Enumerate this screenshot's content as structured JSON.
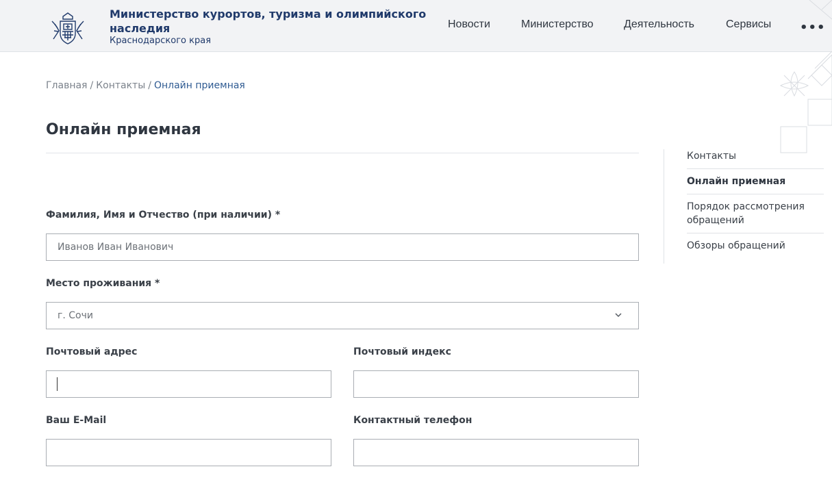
{
  "header": {
    "org_title": "Министерство курортов, туризма и олимпийского наследия",
    "org_subtitle": "Краснодарского края",
    "nav": [
      "Новости",
      "Министерство",
      "Деятельность",
      "Сервисы"
    ],
    "more_label": "•••"
  },
  "breadcrumb": {
    "items": [
      "Главная",
      "Контакты",
      "Онлайн приемная"
    ],
    "separator": "/"
  },
  "page": {
    "title": "Онлайн приемная"
  },
  "form": {
    "fio_label": "Фамилия, Имя и Отчество (при наличии) *",
    "fio_placeholder": "Иванов Иван Иванович",
    "residence_label": "Место проживания *",
    "residence_value": "г. Сочи",
    "postal_address_label": "Почтовый адрес",
    "postal_index_label": "Почтовый индекс",
    "email_label": "Ваш E-Mail",
    "phone_label": "Контактный телефон"
  },
  "side_menu": {
    "items": [
      "Контакты",
      "Онлайн приемная",
      "Порядок рассмотрения обращений",
      "Обзоры обращений"
    ],
    "active_index": 1
  },
  "colors": {
    "brand": "#203a6b",
    "link_current": "#2f5b92",
    "header_bg": "#f2f3f5"
  },
  "icons": {
    "logo": "coat-of-arms-icon",
    "select_chevron": "chevron-down-icon",
    "more": "more-dots-icon"
  }
}
